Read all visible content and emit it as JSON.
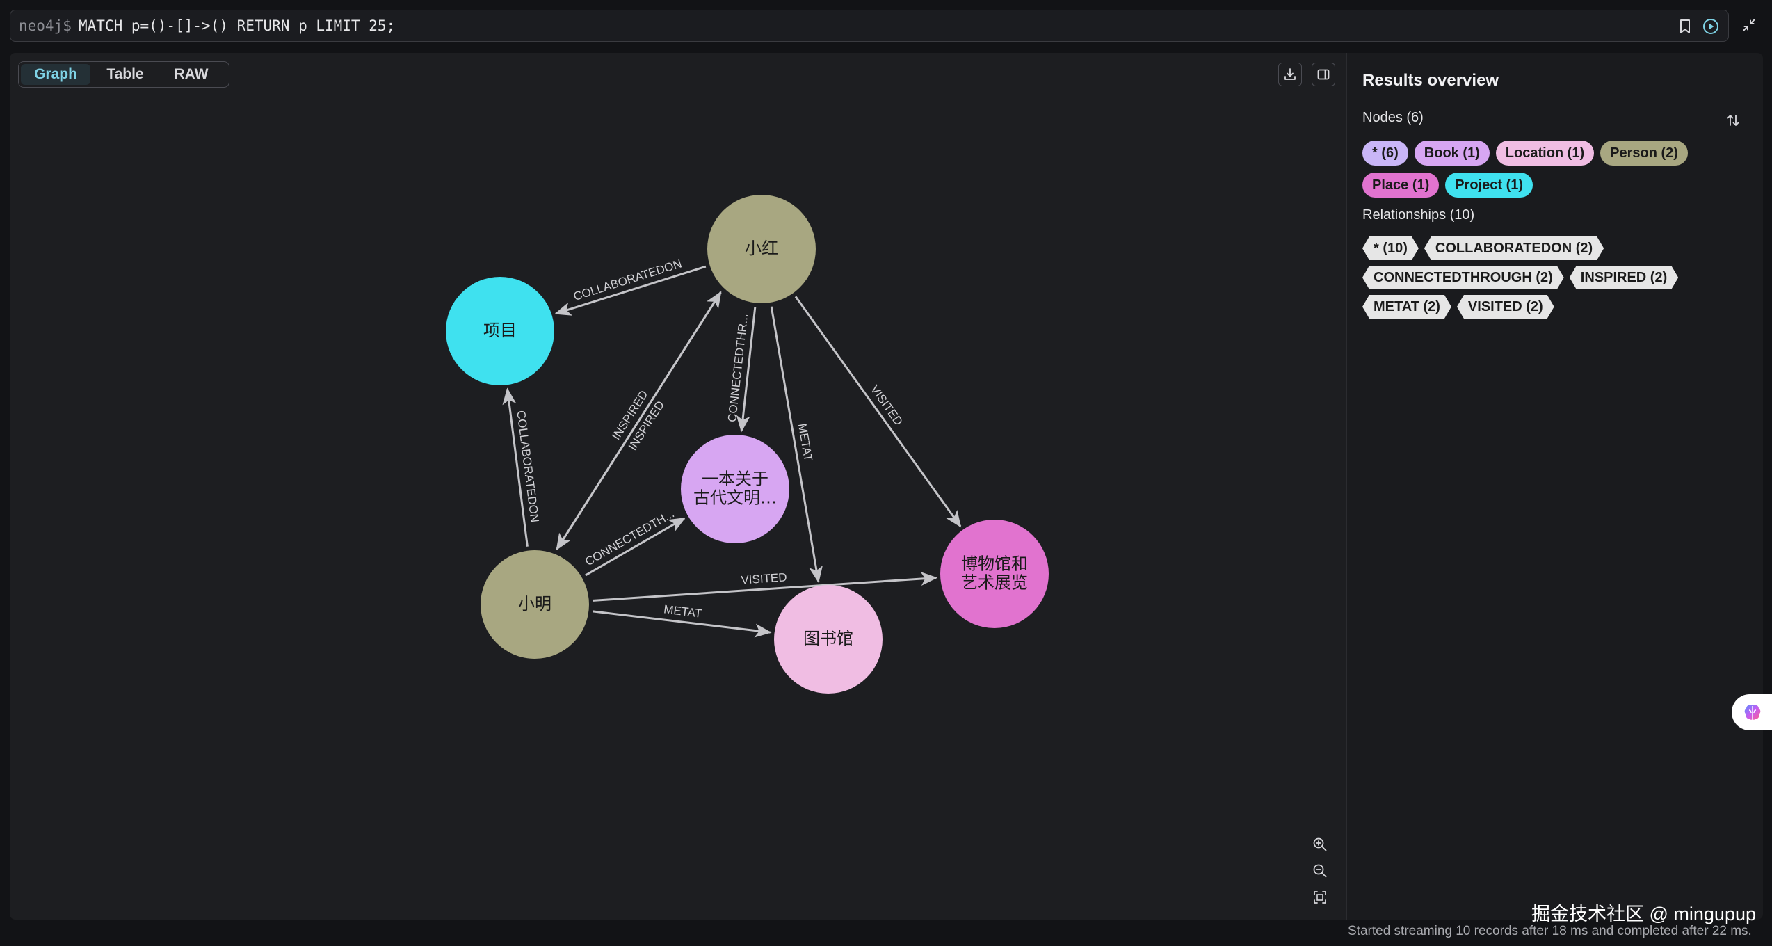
{
  "query": {
    "prompt": "neo4j$",
    "text": "MATCH p=()-[]->() RETURN p LIMIT 25;"
  },
  "view_tabs": [
    {
      "label": "Graph",
      "active": true
    },
    {
      "label": "Table",
      "active": false
    },
    {
      "label": "RAW",
      "active": false
    }
  ],
  "graph": {
    "nodes": [
      {
        "id": "xiaohong",
        "caption": [
          "小红"
        ],
        "label": "Person",
        "color": "#a8a781"
      },
      {
        "id": "xiangmu",
        "caption": [
          "项目"
        ],
        "label": "Project",
        "color": "#3fe1ef"
      },
      {
        "id": "book",
        "caption": [
          "一本关于",
          "古代文明…"
        ],
        "label": "Book",
        "color": "#d7a6f2"
      },
      {
        "id": "museum",
        "caption": [
          "博物馆和",
          "艺术展览"
        ],
        "label": "Place",
        "color": "#e173cf"
      },
      {
        "id": "xiaoming",
        "caption": [
          "小明"
        ],
        "label": "Person",
        "color": "#a8a781"
      },
      {
        "id": "library",
        "caption": [
          "图书馆"
        ],
        "label": "Location",
        "color": "#f0bde3"
      }
    ],
    "relationships": [
      {
        "from": "xiaohong",
        "to": "xiangmu",
        "type": "COLLABORATEDON"
      },
      {
        "from": "xiaoming",
        "to": "xiaohong",
        "type": "INSPIRED"
      },
      {
        "from": "xiaohong",
        "to": "xiaoming",
        "type": "INSPIRED"
      },
      {
        "from": "xiaohong",
        "to": "book",
        "type": "CONNECTEDTHR..."
      },
      {
        "from": "xiaohong",
        "to": "library",
        "type": "METAT"
      },
      {
        "from": "xiaohong",
        "to": "museum",
        "type": "VISITED"
      },
      {
        "from": "xiaoming",
        "to": "xiangmu",
        "type": "COLLABORATEDON"
      },
      {
        "from": "xiaoming",
        "to": "book",
        "type": "CONNECTEDTH..."
      },
      {
        "from": "xiaoming",
        "to": "museum",
        "type": "VISITED"
      },
      {
        "from": "xiaoming",
        "to": "library",
        "type": "METAT"
      }
    ]
  },
  "sidebar": {
    "title": "Results overview",
    "nodes_title": "Nodes (6)",
    "node_labels": [
      {
        "label": "* (6)",
        "color": "#c9b6f7"
      },
      {
        "label": "Book (1)",
        "color": "#d7a6f2"
      },
      {
        "label": "Location (1)",
        "color": "#f0bde3"
      },
      {
        "label": "Person (2)",
        "color": "#a8a781"
      },
      {
        "label": "Place (1)",
        "color": "#e173cf"
      },
      {
        "label": "Project (1)",
        "color": "#3fe1ef"
      }
    ],
    "rels_title": "Relationships (10)",
    "rel_types": [
      {
        "label": "* (10)"
      },
      {
        "label": "COLLABORATEDON (2)"
      },
      {
        "label": "CONNECTEDTHROUGH (2)"
      },
      {
        "label": "INSPIRED (2)"
      },
      {
        "label": "METAT (2)"
      },
      {
        "label": "VISITED (2)"
      }
    ]
  },
  "watermark": "掘金技术社区 @ mingupup",
  "status": "Started streaming 10 records after 18 ms and completed after 22 ms."
}
